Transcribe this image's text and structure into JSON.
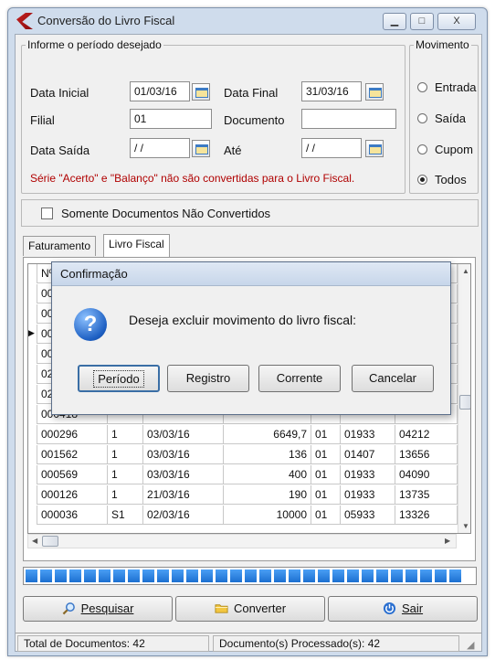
{
  "window": {
    "title": "Conversão do Livro Fiscal",
    "min_label": "▁",
    "max_label": "□",
    "close_label": "X"
  },
  "period": {
    "legend": "Informe o período desejado",
    "data_inicial_label": "Data Inicial",
    "data_inicial_value": "01/03/16",
    "data_final_label": "Data Final",
    "data_final_value": "31/03/16",
    "filial_label": "Filial",
    "filial_value": "01",
    "documento_label": "Documento",
    "documento_value": "",
    "data_saida_label": "Data Saída",
    "data_saida_value": " / /",
    "ate_label": "Até",
    "ate_value": " / /",
    "warning": "Série \"Acerto\" e \"Balanço\" não são convertidas para o Livro Fiscal."
  },
  "movimento": {
    "legend": "Movimento",
    "options": [
      "Entrada",
      "Saída",
      "Cupom",
      "Todos"
    ],
    "selected": "Todos"
  },
  "filter": {
    "label": "Somente Documentos Não Convertidos",
    "checked": false
  },
  "tabs": [
    "Faturamento",
    "Livro Fiscal"
  ],
  "active_tab": "Livro Fiscal",
  "grid": {
    "header": [
      "Nº",
      "",
      "",
      "",
      "",
      "",
      "e"
    ],
    "rows": [
      [
        "00",
        "",
        "",
        "",
        "",
        "",
        ""
      ],
      [
        "00",
        "",
        "",
        "",
        "",
        "",
        ""
      ],
      [
        "00",
        "",
        "",
        "",
        "",
        "",
        ""
      ],
      [
        "00",
        "",
        "",
        "",
        "",
        "",
        ""
      ],
      [
        "02",
        "",
        "",
        "",
        "",
        "",
        ""
      ],
      [
        "02",
        "",
        "",
        "",
        "",
        "",
        ""
      ],
      [
        "000418",
        "",
        "",
        "",
        "",
        "",
        ""
      ],
      [
        "000296",
        "1",
        "03/03/16",
        "6649,7",
        "01",
        "01933",
        "04212"
      ],
      [
        "001562",
        "1",
        "03/03/16",
        "136",
        "01",
        "01407",
        "13656"
      ],
      [
        "000569",
        "1",
        "03/03/16",
        "400",
        "01",
        "01933",
        "04090"
      ],
      [
        "000126",
        "1",
        "21/03/16",
        "190",
        "01",
        "01933",
        "13735"
      ],
      [
        "000036",
        "S1",
        "02/03/16",
        "10000",
        "01",
        "05933",
        "13326"
      ]
    ]
  },
  "progress": {
    "fraction": 1.0,
    "segments": 30
  },
  "buttons": {
    "pesquisar": "Pesquisar",
    "converter": "Converter",
    "sair": "Sair"
  },
  "status": {
    "total": "Total de Documentos: 42",
    "processados": "Documento(s) Processado(s): 42"
  },
  "dialog": {
    "title": "Confirmação",
    "icon": "question-icon",
    "message": "Deseja excluir movimento do livro fiscal:",
    "buttons": [
      "Período",
      "Registro",
      "Corrente",
      "Cancelar"
    ]
  }
}
